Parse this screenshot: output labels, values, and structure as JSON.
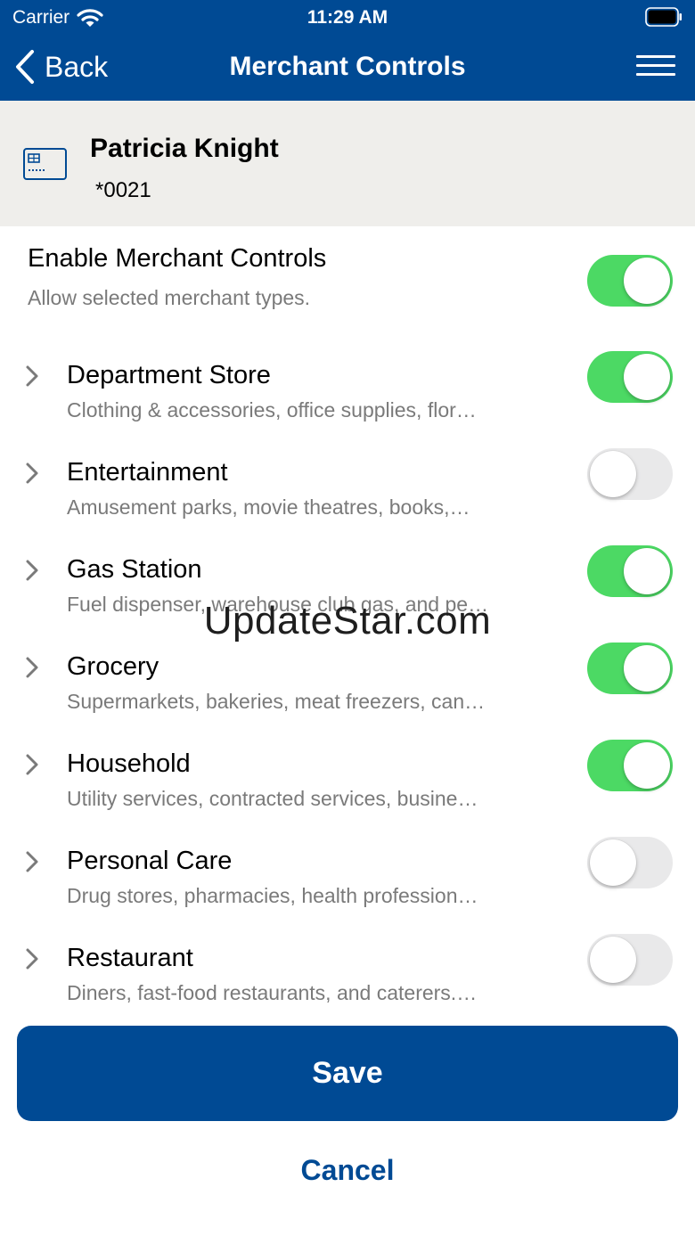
{
  "status_bar": {
    "carrier": "Carrier",
    "time": "11:29 AM",
    "icons": [
      "wifi-icon",
      "battery-icon"
    ]
  },
  "nav": {
    "back_label": "Back",
    "title": "Merchant Controls",
    "icons": [
      "chevron-left-icon",
      "hamburger-menu-icon"
    ]
  },
  "account": {
    "name": "Patricia Knight",
    "number": "*0021",
    "icon": "card-icon"
  },
  "master_toggle": {
    "title": "Enable Merchant Controls",
    "subtitle": "Allow selected merchant types.",
    "on": true
  },
  "categories": [
    {
      "title": "Department Store",
      "subtitle": "Clothing & accessories, office supplies, flor…",
      "on": true
    },
    {
      "title": "Entertainment",
      "subtitle": "Amusement parks, movie theatres, books,…",
      "on": false
    },
    {
      "title": "Gas Station",
      "subtitle": "Fuel dispenser, warehouse club gas, and pe…",
      "on": true
    },
    {
      "title": "Grocery",
      "subtitle": "Supermarkets, bakeries, meat freezers, can…",
      "on": true
    },
    {
      "title": "Household",
      "subtitle": "Utility services, contracted services, busine…",
      "on": true
    },
    {
      "title": "Personal Care",
      "subtitle": "Drug stores, pharmacies, health profession…",
      "on": false
    },
    {
      "title": "Restaurant",
      "subtitle": "Diners, fast-food restaurants, and caterers.…",
      "on": false
    }
  ],
  "watermark": "UpdateStar.com",
  "actions": {
    "save_label": "Save",
    "cancel_label": "Cancel"
  },
  "colors": {
    "brand_blue": "#004a94",
    "toggle_on": "#4cd964",
    "toggle_off": "#e9e9ea",
    "account_bg": "#efeeeb",
    "subtitle_gray": "#7a7a7a"
  }
}
